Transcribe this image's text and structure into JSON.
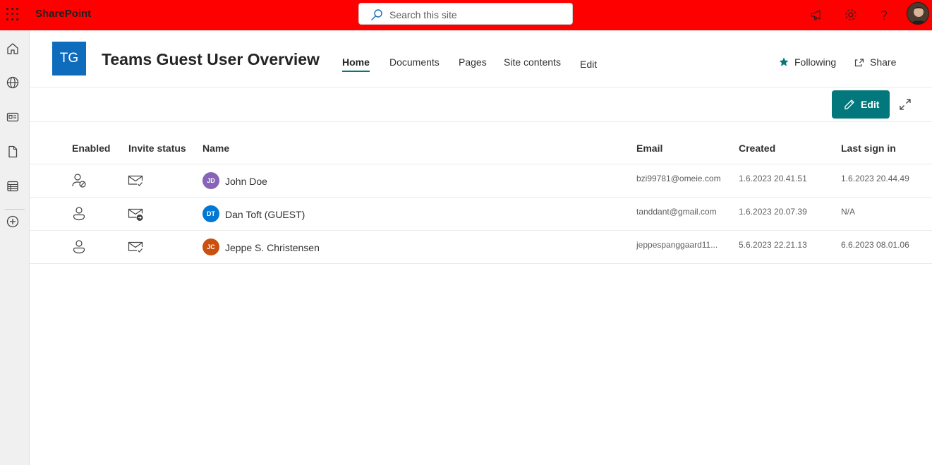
{
  "suite": {
    "app_name": "SharePoint",
    "search_placeholder": "Search this site"
  },
  "site": {
    "logo_initials": "TG",
    "title": "Teams Guest User Overview",
    "nav": [
      "Home",
      "Documents",
      "Pages",
      "Site contents",
      "Edit"
    ],
    "active_nav": "Home",
    "following_label": "Following",
    "share_label": "Share"
  },
  "toolbar": {
    "edit_label": "Edit"
  },
  "table": {
    "headers": {
      "enabled": "Enabled",
      "invite_status": "Invite status",
      "name": "Name",
      "email": "Email",
      "created": "Created",
      "last_sign_in": "Last sign in"
    },
    "rows": [
      {
        "enabled_icon": "person-blocked-icon",
        "invite_icon": "mail-checkmark-icon",
        "initials": "JD",
        "persona_color": "#8764b8",
        "name": "John Doe",
        "email": "bzi99781@omeie.com",
        "created": "1.6.2023 20.41.51",
        "last_sign_in": "1.6.2023 20.44.49"
      },
      {
        "enabled_icon": "person-icon",
        "invite_icon": "mail-arrow-forward-icon",
        "initials": "DT",
        "persona_color": "#0078d4",
        "name": "Dan Toft (GUEST)",
        "email": "tanddant@gmail.com",
        "created": "1.6.2023 20.07.39",
        "last_sign_in": "N/A"
      },
      {
        "enabled_icon": "person-icon",
        "invite_icon": "mail-checkmark-icon",
        "initials": "JC",
        "persona_color": "#ca5010",
        "name": "Jeppe S. Christensen",
        "email": "jeppespanggaard11...",
        "created": "5.6.2023 22.21.13",
        "last_sign_in": "6.6.2023 08.01.06"
      }
    ]
  },
  "colors": {
    "suite_bar": "#ff0000",
    "theme_primary": "#03787c",
    "site_logo": "#0f6cbd"
  }
}
